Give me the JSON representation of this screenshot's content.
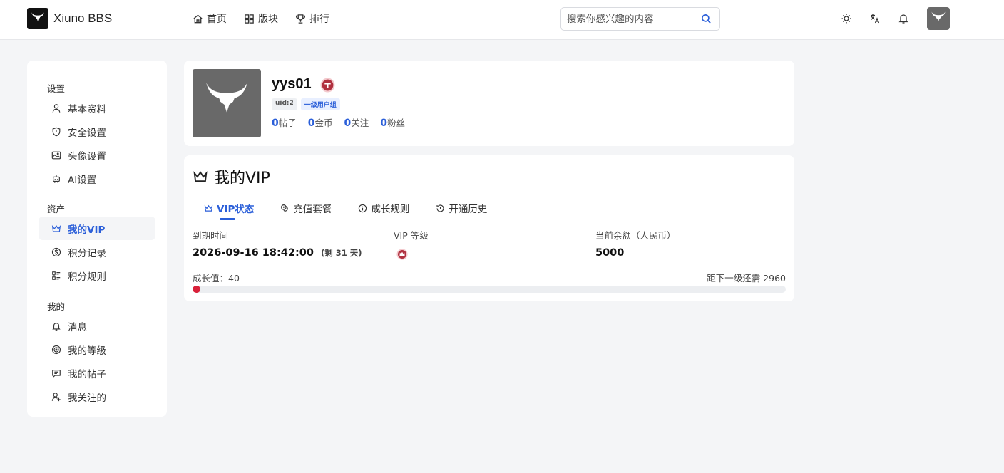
{
  "header": {
    "logo_text": "Xiuno BBS",
    "nav": [
      {
        "label": "首页",
        "icon": "home-icon"
      },
      {
        "label": "版块",
        "icon": "grid-icon"
      },
      {
        "label": "排行",
        "icon": "trophy-icon"
      }
    ],
    "search_placeholder": "搜索你感兴趣的内容",
    "icons": [
      "sun-icon",
      "translate-icon",
      "bell-icon"
    ]
  },
  "sidebar": {
    "groups": [
      {
        "title": "设置",
        "items": [
          {
            "label": "基本资料",
            "icon": "user-icon"
          },
          {
            "label": "安全设置",
            "icon": "shield-icon"
          },
          {
            "label": "头像设置",
            "icon": "image-icon"
          },
          {
            "label": "AI设置",
            "icon": "robot-icon"
          }
        ]
      },
      {
        "title": "资产",
        "items": [
          {
            "label": "我的VIP",
            "icon": "crown-icon",
            "active": true
          },
          {
            "label": "积分记录",
            "icon": "coin-icon"
          },
          {
            "label": "积分规则",
            "icon": "list-icon"
          }
        ]
      },
      {
        "title": "我的",
        "items": [
          {
            "label": "消息",
            "icon": "bell-icon"
          },
          {
            "label": "我的等级",
            "icon": "level-icon"
          },
          {
            "label": "我的帖子",
            "icon": "message-icon"
          },
          {
            "label": "我关注的",
            "icon": "user-plus-icon"
          }
        ]
      }
    ]
  },
  "profile": {
    "username": "yys01",
    "uid_tag": "uid:2",
    "group_tag": "一级用户组",
    "stats": [
      {
        "num": "0",
        "label": "帖子"
      },
      {
        "num": "0",
        "label": "金币"
      },
      {
        "num": "0",
        "label": "关注"
      },
      {
        "num": "0",
        "label": "粉丝"
      }
    ]
  },
  "vip": {
    "title": "我的VIP",
    "tabs": [
      {
        "label": "VIP状态",
        "icon": "crown-icon",
        "active": true
      },
      {
        "label": "充值套餐",
        "icon": "coins-icon"
      },
      {
        "label": "成长规则",
        "icon": "info-icon"
      },
      {
        "label": "开通历史",
        "icon": "history-icon"
      }
    ],
    "expire_label": "到期时间",
    "expire_value": "2026-09-16 18:42:00",
    "expire_remaining": "(剩 31 天)",
    "level_label": "VIP 等级",
    "balance_label": "当前余额（人民币）",
    "balance_value": "5000",
    "growth_label": "成长值：40",
    "next_level_text": "距下一级还需 2960",
    "growth_progress_pct": 1.3
  },
  "colors": {
    "accent": "#2b5fd9",
    "progress": "#d9213a",
    "badge": "#b0303f"
  }
}
